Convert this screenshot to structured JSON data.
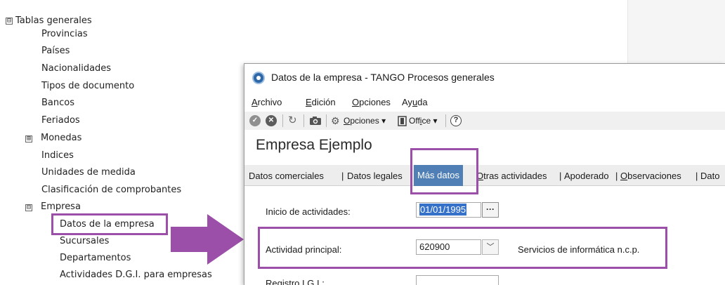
{
  "tree": {
    "root": "Tablas generales",
    "items": [
      "Provincias",
      "Países",
      "Nacionalidades",
      "Tipos de documento",
      "Bancos",
      "Feriados",
      "Monedas",
      "Indices",
      "Unidades de medida",
      "Clasificación de comprobantes",
      "Empresa"
    ],
    "empresa_children": [
      "Datos de la empresa",
      "Sucursales",
      "Departamentos",
      "Actividades D.G.I. para empresas"
    ],
    "expanded_symbol": "⊟",
    "collapsed_symbol": "⊞"
  },
  "window": {
    "title": "Datos de la empresa - TANGO Procesos generales",
    "menu": {
      "archivo": {
        "accel": "A",
        "rest": "rchivo"
      },
      "edicion": {
        "accel": "E",
        "rest": "dición"
      },
      "opciones": {
        "accel": "O",
        "rest": "pciones"
      },
      "ayuda": {
        "pre": "Ay",
        "accel": "u",
        "rest": "da"
      }
    },
    "toolbar": {
      "opciones": {
        "accel": "O",
        "rest": "pciones"
      },
      "office": {
        "pre": "Off",
        "accel": "i",
        "rest": "ce"
      },
      "dropdown_glyph": "▾",
      "help_glyph": "?"
    },
    "company_name": "Empresa Ejemplo",
    "tabs": {
      "comerciales": "Datos comerciales",
      "legales": "Datos legales",
      "mas_datos": "Más datos",
      "otras": {
        "accel": "O",
        "rest": "tras actividades"
      },
      "apoderado": "Apoderado",
      "observaciones": {
        "accel": "O",
        "rest": "bservaciones"
      },
      "cut": "Dato",
      "separator": "|"
    },
    "form": {
      "inicio_label": "Inicio de actividades:",
      "inicio_value": "01/01/1995",
      "dots_label": "···",
      "actividad_label": "Actividad principal:",
      "actividad_code": "620900",
      "chevron": "﹀",
      "actividad_desc": "Servicios de informática n.c.p.",
      "partial_label": "Registro I.G.I.:"
    }
  },
  "colors": {
    "highlight": "#9b4fa8",
    "arrow": "#9b4fa8",
    "active_tab": "#4f7fb4",
    "selection": "#3571c9"
  }
}
